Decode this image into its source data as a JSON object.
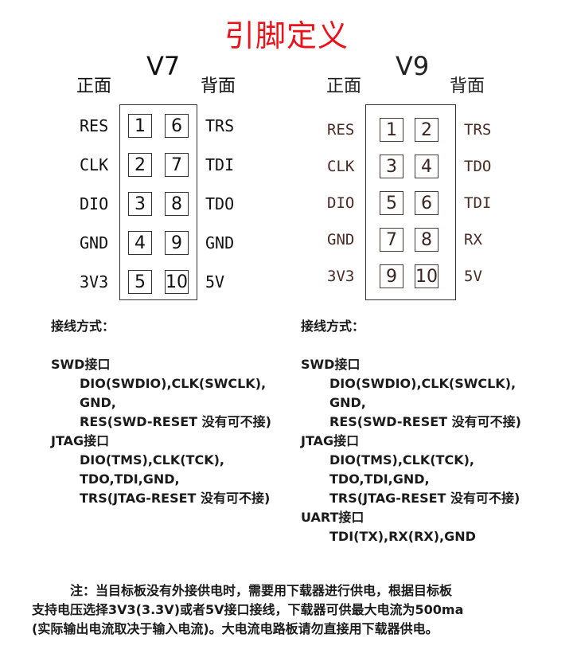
{
  "title": "引脚定义",
  "v7": {
    "version": "V7",
    "front": "正面",
    "back": "背面",
    "left_labels": [
      "RES",
      "CLK",
      "DIO",
      "GND",
      "3V3"
    ],
    "right_labels": [
      "TRS",
      "TDI",
      "TDO",
      "GND",
      "5V"
    ],
    "left_pins": [
      "1",
      "2",
      "3",
      "4",
      "5"
    ],
    "right_pins": [
      "6",
      "7",
      "8",
      "9",
      "10"
    ]
  },
  "v9": {
    "version": "V9",
    "front": "正面",
    "back": "背面",
    "left_labels": [
      "RES",
      "CLK",
      "DIO",
      "GND",
      "3V3"
    ],
    "right_labels": [
      "TRS",
      "TDO",
      "TDI",
      "RX",
      "5V"
    ],
    "left_pins": [
      "1",
      "3",
      "5",
      "7",
      "9"
    ],
    "right_pins": [
      "2",
      "4",
      "6",
      "8",
      "10"
    ]
  },
  "wiring_v7": {
    "heading": "接线方式：",
    "lines": [
      {
        "text": "SWD接口",
        "indent": false
      },
      {
        "text": "DIO(SWDIO),CLK(SWCLK),",
        "indent": true
      },
      {
        "text": "GND,",
        "indent": true
      },
      {
        "text": "RES(SWD-RESET 没有可不接)",
        "indent": true
      },
      {
        "text": "JTAG接口",
        "indent": false
      },
      {
        "text": "DIO(TMS),CLK(TCK),",
        "indent": true
      },
      {
        "text": "TDO,TDI,GND,",
        "indent": true
      },
      {
        "text": "TRS(JTAG-RESET 没有可不接)",
        "indent": true
      }
    ]
  },
  "wiring_v9": {
    "heading": "接线方式：",
    "lines": [
      {
        "text": "SWD接口",
        "indent": false
      },
      {
        "text": "DIO(SWDIO),CLK(SWCLK),",
        "indent": true
      },
      {
        "text": "GND,",
        "indent": true
      },
      {
        "text": "RES(SWD-RESET 没有可不接)",
        "indent": true
      },
      {
        "text": "JTAG接口",
        "indent": false
      },
      {
        "text": "DIO(TMS),CLK(TCK),",
        "indent": true
      },
      {
        "text": "TDO,TDI,GND,",
        "indent": true
      },
      {
        "text": "TRS(JTAG-RESET 没有可不接)",
        "indent": true
      },
      {
        "text": "UART接口",
        "indent": false
      },
      {
        "text": "TDI(TX),RX(RX),GND",
        "indent": true
      }
    ]
  },
  "note": {
    "line1": "注：当目标板没有外接供电时，需要用下载器进行供电，根据目标板",
    "line2": "支持电压选择3V3(3.3V)或者5V接口接线，下载器可供最大电流为500ma",
    "line3": "(实际输出电流取决于输入电流)。大电流电路板请勿直接用下载器供电。"
  }
}
